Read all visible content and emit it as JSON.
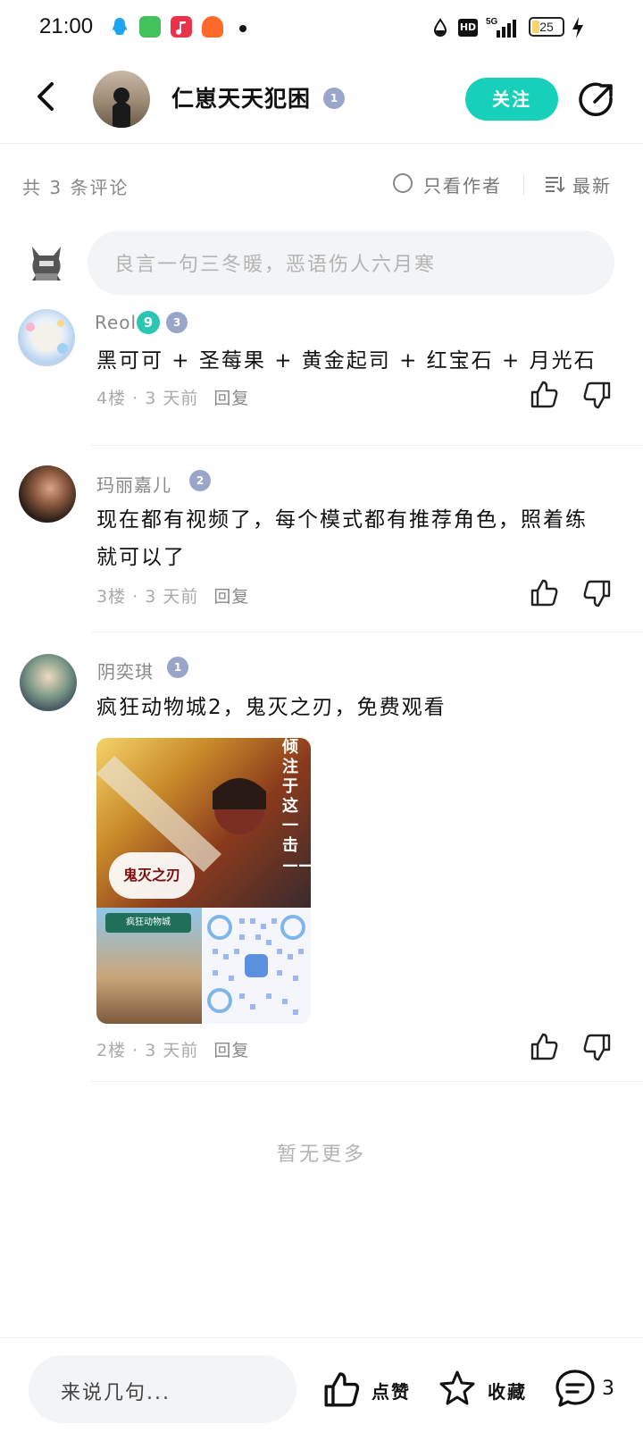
{
  "status_bar": {
    "time": "21:00",
    "battery": "25",
    "battery_level": 0.25,
    "icons": [
      "qq-icon",
      "green-app-icon",
      "music-app-icon",
      "orange-app-icon",
      "dot-indicator",
      "water-drop-icon",
      "hd-icon",
      "5g-signal-icon",
      "battery-icon",
      "charging-icon"
    ]
  },
  "header": {
    "author_name": "仁崽天天犯困",
    "level_badge": "1",
    "follow_label": "关注"
  },
  "filter": {
    "count_text": "共 3 条评论",
    "author_only_label": "只看作者",
    "sort_label": "最新"
  },
  "compose": {
    "placeholder": "良言一句三冬暖，恶语伤人六月寒"
  },
  "comments": [
    {
      "username": "Reol",
      "badge_level": "9",
      "title_level": "3",
      "text": "黑可可 + 圣莓果 + 黄金起司 + 红宝石 + 月光石",
      "floor": "4楼",
      "time": "3 天前",
      "reply_label": "回复"
    },
    {
      "username": "玛丽嘉儿",
      "title_level": "2",
      "text": "现在都有视频了，每个模式都有推荐角色，照着练就可以了",
      "floor": "3楼",
      "time": "3 天前",
      "reply_label": "回复"
    },
    {
      "username": "阴奕琪",
      "title_level": "1",
      "text": "疯狂动物城2，鬼灭之刃，免费观看",
      "image_text": {
        "poster_title": "鬼灭之刃",
        "poster_caption": "倾注于这一击——!!",
        "zootopia_title": "疯狂动物城"
      },
      "floor": "2楼",
      "time": "3 天前",
      "reply_label": "回复"
    }
  ],
  "meta_separator": "·",
  "no_more": "暂无更多",
  "bottom_bar": {
    "input_placeholder": "来说几句...",
    "like_label": "点赞",
    "favorite_label": "收藏",
    "comment_count": "3"
  },
  "colors": {
    "accent": "#17d0ba",
    "badge_level": "#2bc6b3",
    "title_badge": "#9aa6c9"
  }
}
